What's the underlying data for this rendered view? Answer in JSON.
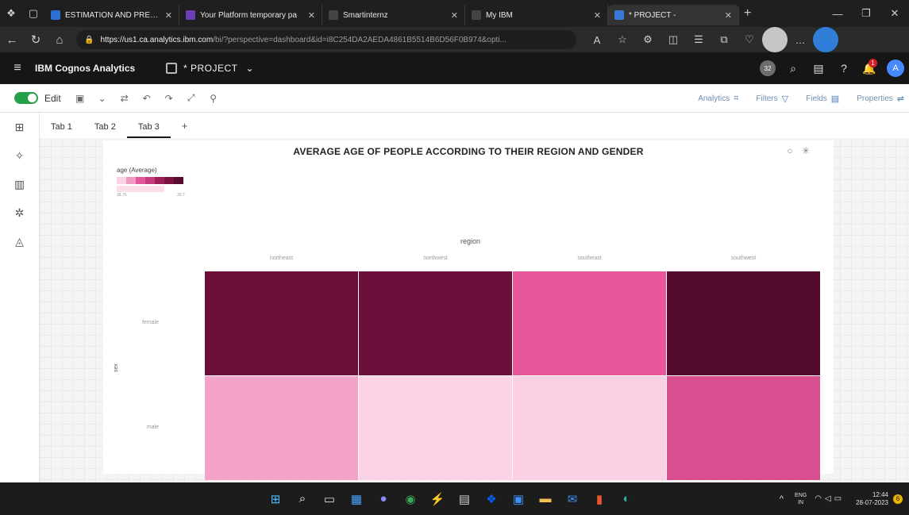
{
  "browser": {
    "tabs": [
      {
        "label": "ESTIMATION AND PREDICTI",
        "favicon_color": "#2f6fd1"
      },
      {
        "label": "Your Platform temporary pa",
        "favicon_color": "#6d3fb5"
      },
      {
        "label": "Smartinternz",
        "favicon_color": "#444444"
      },
      {
        "label": "My IBM",
        "favicon_color": "#444444"
      },
      {
        "label": "* PROJECT -",
        "favicon_color": "#3a7ad6"
      }
    ],
    "url_host": "https://us1.ca.analytics.ibm.com",
    "url_path": "/bi/?perspective=dashboard&id=i8C254DA2AEDA4861B5514B6D56F0B974&opti..."
  },
  "app": {
    "brand": "IBM Cognos Analytics",
    "project_name": "* PROJECT",
    "badge_count": "32",
    "notification_count": "1",
    "user_initial": "A"
  },
  "toolbar": {
    "edit_label": "Edit",
    "analytics_label": "Analytics",
    "filters_label": "Filters",
    "fields_label": "Fields",
    "properties_label": "Properties"
  },
  "dashboard_tabs": [
    {
      "label": "Tab 1"
    },
    {
      "label": "Tab 2"
    },
    {
      "label": "Tab 3",
      "active": true
    }
  ],
  "chart_data": {
    "type": "heatmap",
    "title": "AVERAGE AGE OF PEOPLE ACCORDING TO THEIR REGION AND GENDER",
    "x_title": "region",
    "y_title": "sex",
    "legend_title": "age (Average)",
    "legend_min": "38.76",
    "legend_max": "39.7",
    "x_categories": [
      "northeast",
      "northwest",
      "southeast",
      "southwest"
    ],
    "y_categories": [
      "female",
      "male"
    ],
    "values": [
      [
        39.6,
        39.5,
        39.0,
        39.7
      ],
      [
        38.85,
        38.8,
        38.8,
        39.1
      ]
    ],
    "colors": [
      [
        "#6b0f38",
        "#6c0f3a",
        "#e8579a",
        "#550b2e"
      ],
      [
        "#f3a3c8",
        "#fbd3e6",
        "#fbd0e4",
        "#d94e8f"
      ]
    ],
    "legend_colors": [
      "#fbd3e6",
      "#f19bc3",
      "#e3579a",
      "#c43c7c",
      "#9e1d58",
      "#7a1141",
      "#5a0b2e"
    ]
  },
  "taskbar": {
    "lang_line1": "ENG",
    "lang_line2": "IN",
    "time": "12:44",
    "date": "28-07-2023",
    "notif_count": "6"
  }
}
